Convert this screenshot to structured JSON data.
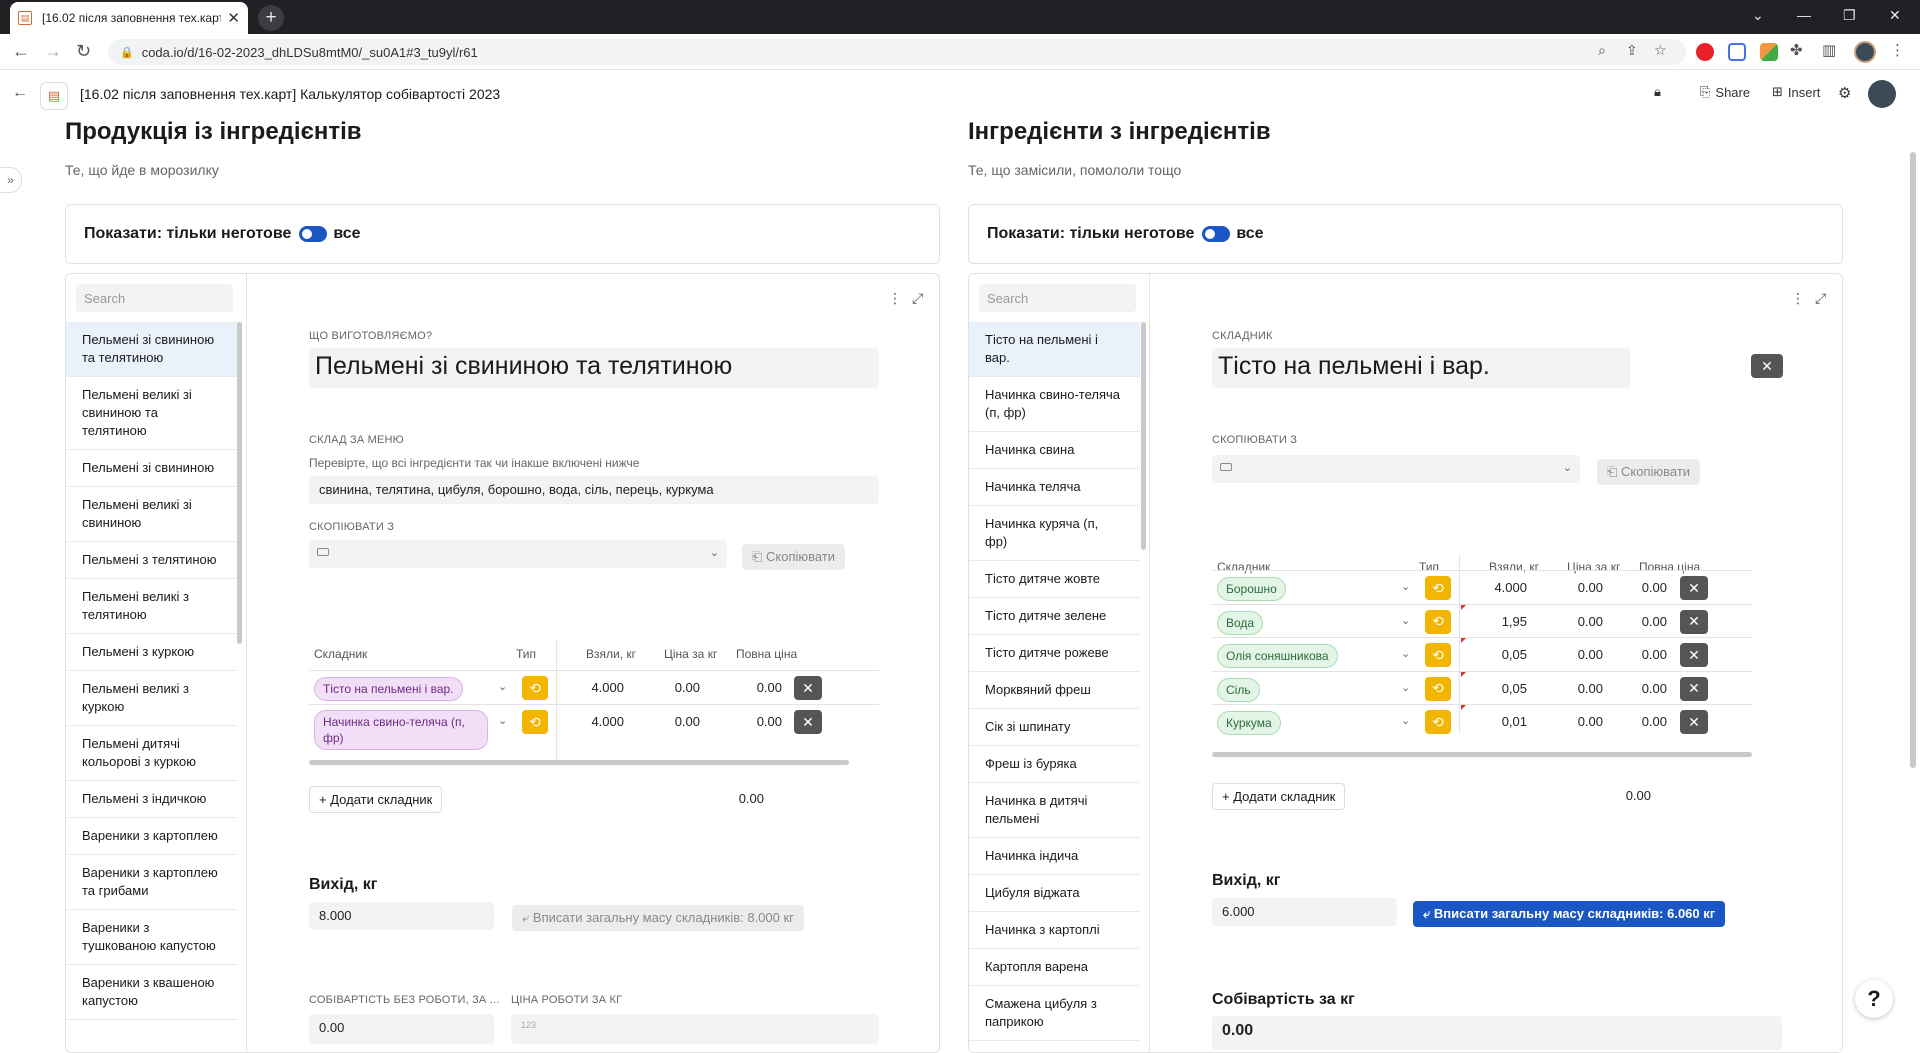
{
  "browser": {
    "tab_title": "[16.02 після заповнення тех.карт",
    "url": "coda.io/d/16-02-2023_dhLDSu8mtM0/_su0A1#3_tu9yl/r61"
  },
  "doc": {
    "title": "[16.02 після заповнення тех.карт] Калькулятор собівартості 2023",
    "share": "Share",
    "insert": "Insert"
  },
  "left": {
    "title": "Продукція із інгредієнтів",
    "subtitle": "Те, що йде в морозилку",
    "filter": {
      "label": "Показати: тільки неготове",
      "all": "все"
    },
    "search": "Search",
    "items": [
      "Пельмені зі свининою та телятиною",
      "Пельмені великі зі свининою та телятиною",
      "Пельмені зі свининою",
      "Пельмені великі зі свининою",
      "Пельмені з телятиною",
      "Пельмені великі з телятиною",
      "Пельмені з куркою",
      "Пельмені великі з куркою",
      "Пельмені дитячі кольорові з куркою",
      "Пельмені з індичкою",
      "Вареники з картоплею",
      "Вареники з картоплею та грибами",
      "Вареники з тушкованою капустою",
      "Вареники з квашеною капустою"
    ],
    "detail": {
      "what_label": "ЩО ВИГОТОВЛЯЄМО?",
      "what_value": "Пельмені зі свининою та телятиною",
      "menu_label": "СКЛАД ЗА МЕНЮ",
      "menu_hint": "Перевірте, що всі інгредієнти так чи інакше включені нижче",
      "menu_value": "свинина, телятина, цибуля, борошно, вода, сіль, перець, куркума",
      "copy_label": "СКОПІЮВАТИ З",
      "copy_btn": "Скопіювати",
      "table_headers": [
        "Складник",
        "Тип",
        "Взяли, кг",
        "Ціна за кг",
        "Повна ціна"
      ],
      "rows": [
        {
          "name": "Тісто на пельмені і вар.",
          "kg": "4.000",
          "price": "0.00",
          "total": "0.00"
        },
        {
          "name": "Начинка свино-теляча (п, фр)",
          "kg": "4.000",
          "price": "0.00",
          "total": "0.00"
        }
      ],
      "add_btn": "Додати складник",
      "sum": "0.00",
      "yield_title": "Вихід, кг",
      "yield_value": "8.000",
      "fill_btn": "Вписати загальну масу складників: 8.000 кг",
      "cost_label": "СОБІВАРТІСТЬ БЕЗ РОБОТИ, ЗА ...",
      "cost_value": "0.00",
      "work_label": "ЦІНА РОБОТИ ЗА КГ",
      "work_placeholder": "123"
    }
  },
  "right": {
    "title": "Інгредієнти з інгредієнтів",
    "subtitle": "Те, що замісили, помололи тощо",
    "filter": {
      "label": "Показати: тільки неготове",
      "all": "все"
    },
    "search": "Search",
    "items": [
      "Тісто на пельмені і вар.",
      "Начинка свино-теляча (п, фр)",
      "Начинка свина",
      "Начинка теляча",
      "Начинка куряча (п, фр)",
      "Тісто дитяче жовте",
      "Тісто дитяче зелене",
      "Тісто дитяче рожеве",
      "Морквяний фреш",
      "Сік зі шпинату",
      "Фреш із буряка",
      "Начинка в дитячі пельмені",
      "Начинка індича",
      "Цибуля віджата",
      "Начинка з картоплі",
      "Картопля варена",
      "Смажена цибуля з паприкою"
    ],
    "detail": {
      "what_label": "СКЛАДНИК",
      "what_value": "Тісто на пельмені і вар.",
      "copy_label": "СКОПІЮВАТИ З",
      "copy_btn": "Скопіювати",
      "table_headers": [
        "Складник",
        "Тип",
        "Взяли, кг",
        "Ціна за кг",
        "Повна ціна"
      ],
      "rows": [
        {
          "name": "Борошно",
          "kg": "4.000",
          "price": "0.00",
          "total": "0.00"
        },
        {
          "name": "Вода",
          "kg": "1,95",
          "price": "0.00",
          "total": "0.00"
        },
        {
          "name": "Олія соняшникова",
          "kg": "0,05",
          "price": "0.00",
          "total": "0.00"
        },
        {
          "name": "Сіль",
          "kg": "0,05",
          "price": "0.00",
          "total": "0.00"
        },
        {
          "name": "Куркума",
          "kg": "0,01",
          "price": "0.00",
          "total": "0.00"
        }
      ],
      "add_btn": "Додати складник",
      "sum": "0.00",
      "yield_title": "Вихід, кг",
      "yield_value": "6.000",
      "fill_btn": "Вписати загальну масу складників: 6.060 кг",
      "cost_title": "Собівартість за кг",
      "cost_value": "0.00"
    }
  }
}
